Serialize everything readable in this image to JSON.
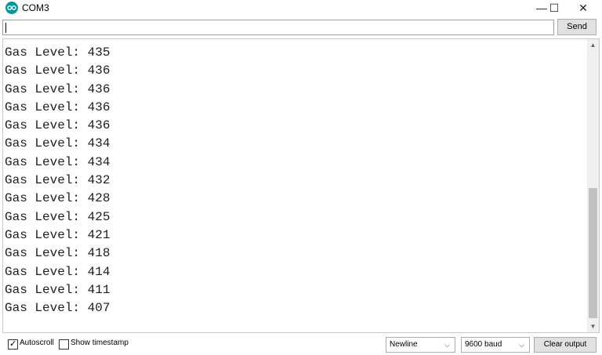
{
  "window": {
    "title": "COM3",
    "minimize_glyph": "—",
    "maximize_glyph": "☐",
    "close_glyph": "✕"
  },
  "input": {
    "value": "",
    "send_label": "Send"
  },
  "output": {
    "lines": [
      "Gas Level: 435",
      "Gas Level: 436",
      "Gas Level: 436",
      "Gas Level: 436",
      "Gas Level: 436",
      "Gas Level: 434",
      "Gas Level: 434",
      "Gas Level: 432",
      "Gas Level: 428",
      "Gas Level: 425",
      "Gas Level: 421",
      "Gas Level: 418",
      "Gas Level: 414",
      "Gas Level: 411",
      "Gas Level: 407"
    ]
  },
  "footer": {
    "autoscroll_label": "Autoscroll",
    "autoscroll_checked": true,
    "timestamp_label": "Show timestamp",
    "timestamp_checked": false,
    "line_ending": "Newline",
    "baud_rate": "9600 baud",
    "clear_label": "Clear output"
  },
  "colors": {
    "app_icon": "#00979c"
  }
}
